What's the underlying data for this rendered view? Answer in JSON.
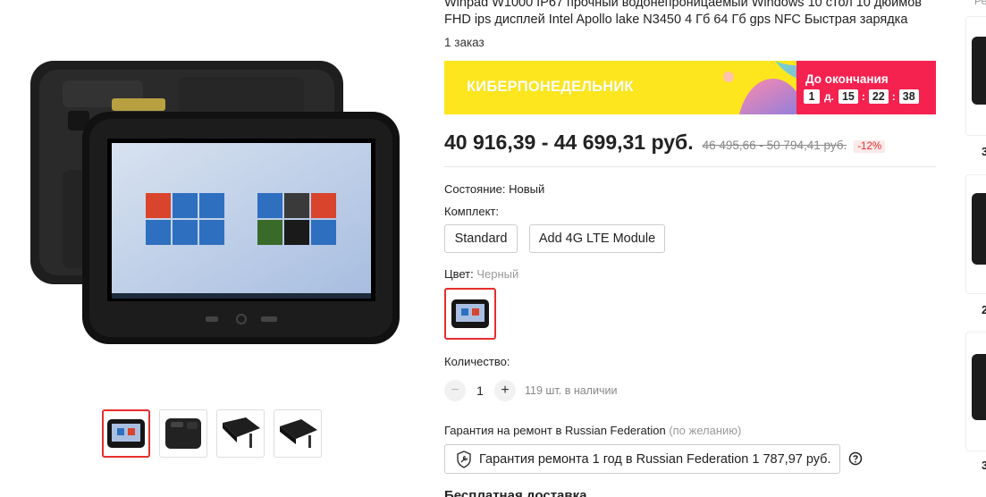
{
  "product": {
    "title": "Winpad W1000 IP67 прочный водонепроницаемый Windows 10 стол 10 дюймов FHD ips дисплей Intel Apollo lake N3450 4 Гб 64 Гб gps NFC Быстрая зарядка",
    "orders": "1 заказ"
  },
  "promo": {
    "label": "КИБЕРПОНЕДЕЛЬНИК",
    "timer_title": "До окончания",
    "days": "1",
    "days_suffix": "д.",
    "hours": "15",
    "minutes": "22",
    "seconds": "38",
    "sep": ":",
    "bg_color": "#fde61e",
    "timer_color": "#f5214f"
  },
  "price": {
    "current": "40 916,39 - 44 699,31 руб.",
    "old": "46 495,66 - 50 794,41 руб.",
    "discount": "-12%"
  },
  "condition": {
    "label": "Состояние:",
    "value": "Новый"
  },
  "bundle": {
    "label": "Комплект:",
    "options": [
      "Standard",
      "Add 4G LTE Module"
    ]
  },
  "color": {
    "label": "Цвет:",
    "value": "Черный"
  },
  "quantity": {
    "label": "Количество:",
    "minus": "−",
    "plus": "+",
    "value": "1",
    "stock": "119 шт. в наличии"
  },
  "warranty": {
    "label": "Гарантия на ремонт в Russian Federation",
    "note": "(по желанию)",
    "button": "Гарантия ремонта 1 год в Russian Federation 1 787,97 руб."
  },
  "delivery": {
    "title": "Бесплатная доставка"
  },
  "recommendations": {
    "title": "Ре",
    "numbers": [
      "3",
      "2",
      "3"
    ]
  },
  "accent_color": "#e62e2e"
}
